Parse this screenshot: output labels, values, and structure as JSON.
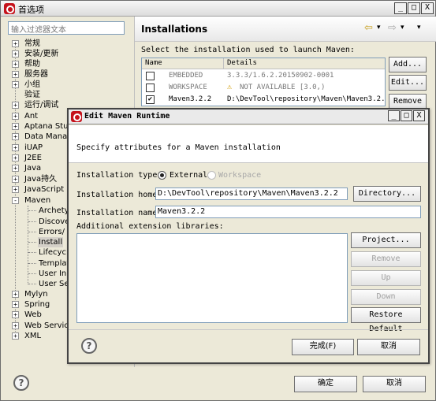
{
  "window": {
    "title": "首选项",
    "filter_placeholder": "输入过滤器文本",
    "controls": [
      "_",
      "□",
      "X"
    ]
  },
  "tree": {
    "items": [
      {
        "label": "常规",
        "expander": "+"
      },
      {
        "label": "安装/更新",
        "expander": "+"
      },
      {
        "label": "帮助",
        "expander": "+"
      },
      {
        "label": "服务器",
        "expander": "+"
      },
      {
        "label": "小组",
        "expander": "+"
      },
      {
        "label": "验证",
        "expander": ""
      },
      {
        "label": "运行/调试",
        "expander": "+"
      },
      {
        "label": "Ant",
        "expander": "+"
      },
      {
        "label": "Aptana Stu",
        "expander": "+"
      },
      {
        "label": "Data Manag",
        "expander": "+"
      },
      {
        "label": "iUAP",
        "expander": "+"
      },
      {
        "label": "J2EE",
        "expander": "+"
      },
      {
        "label": "Java",
        "expander": "+"
      },
      {
        "label": "Java持久",
        "expander": "+"
      },
      {
        "label": "JavaScript",
        "expander": "+"
      },
      {
        "label": "Maven",
        "expander": "-"
      },
      {
        "label": "Archety",
        "expander": "",
        "child": true
      },
      {
        "label": "Discove",
        "expander": "",
        "child": true
      },
      {
        "label": "Errors/",
        "expander": "",
        "child": true
      },
      {
        "label": "Install",
        "expander": "",
        "child": true,
        "selected": true
      },
      {
        "label": "Lifecyc",
        "expander": "",
        "child": true
      },
      {
        "label": "Templat",
        "expander": "",
        "child": true
      },
      {
        "label": "User In",
        "expander": "",
        "child": true
      },
      {
        "label": "User Se",
        "expander": "",
        "child": true
      },
      {
        "label": "Mylyn",
        "expander": "+"
      },
      {
        "label": "Spring",
        "expander": "+"
      },
      {
        "label": "Web",
        "expander": "+"
      },
      {
        "label": "Web Servic",
        "expander": "+"
      },
      {
        "label": "XML",
        "expander": "+"
      }
    ]
  },
  "installations": {
    "title": "Installations",
    "nav_icons": [
      "⇦",
      "▾",
      "⇨",
      "▾",
      "▾"
    ],
    "description": "Select the installation used to launch Maven:",
    "columns": [
      "Name",
      "Details"
    ],
    "rows": [
      {
        "checked": false,
        "name": "EMBEDDED",
        "details": "3.3.3/1.6.2.20150902-0001",
        "dim": true,
        "warning": false
      },
      {
        "checked": false,
        "name": "WORKSPACE",
        "details": "NOT AVAILABLE [3.0,)",
        "dim": true,
        "warning": true
      },
      {
        "checked": true,
        "name": "Maven3.2.2",
        "details": "D:\\DevTool\\repository\\Maven\\Maven3.2.2",
        "dim": false,
        "warning": false
      }
    ],
    "buttons": {
      "add": "Add...",
      "edit": "Edit...",
      "remove": "Remove"
    }
  },
  "dialog": {
    "title": "Edit Maven Runtime",
    "message": "Specify attributes for a Maven installation",
    "type_label": "Installation type:",
    "type_external": "External",
    "type_workspace": "Workspace",
    "home_label": "Installation home:",
    "home_value": "D:\\DevTool\\repository\\Maven\\Maven3.2.2",
    "directory_button": "Directory...",
    "name_label": "Installation name:",
    "name_value": "Maven3.2.2",
    "ext_label": "Additional extension libraries:",
    "buttons": {
      "project": "Project...",
      "remove": "Remove",
      "up": "Up",
      "down": "Down",
      "restore": "Restore Default",
      "finish": "完成(F)",
      "cancel": "取消"
    },
    "controls": [
      "_",
      "□",
      "X"
    ]
  },
  "footer": {
    "ok": "确定",
    "cancel": "取消",
    "help": "?"
  }
}
